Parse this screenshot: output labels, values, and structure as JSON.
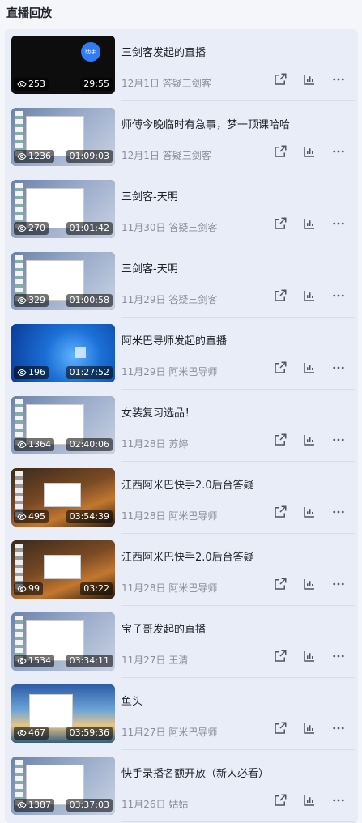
{
  "header": {
    "title": "直播回放"
  },
  "items": [
    {
      "title": "三剑客发起的直播",
      "date": "12月1日",
      "host": "答疑三剑客",
      "views": "253",
      "duration": "29:55",
      "scene": "dark"
    },
    {
      "title": "师傅今晚临时有急事，梦一顶课哈哈",
      "date": "12月1日",
      "host": "答疑三剑客",
      "views": "1236",
      "duration": "01:09:03",
      "scene": "desktop"
    },
    {
      "title": "三剑客-天明",
      "date": "11月30日",
      "host": "答疑三剑客",
      "views": "270",
      "duration": "01:01:42",
      "scene": "desktop"
    },
    {
      "title": "三剑客-天明",
      "date": "11月29日",
      "host": "答疑三剑客",
      "views": "329",
      "duration": "01:00:58",
      "scene": "desktop"
    },
    {
      "title": "阿米巴导师发起的直播",
      "date": "11月29日",
      "host": "阿米巴导师",
      "views": "196",
      "duration": "01:27:52",
      "scene": "win"
    },
    {
      "title": "女装复习选品！",
      "date": "11月28日",
      "host": "苏婷",
      "views": "1364",
      "duration": "02:40:06",
      "scene": "desktop"
    },
    {
      "title": "江西阿米巴快手2.0后台答疑",
      "date": "11月28日",
      "host": "阿米巴导师",
      "views": "495",
      "duration": "03:54:39",
      "scene": "tiger"
    },
    {
      "title": "江西阿米巴快手2.0后台答疑",
      "date": "11月28日",
      "host": "阿米巴导师",
      "views": "99",
      "duration": "03:22",
      "scene": "tiger"
    },
    {
      "title": "宝子哥发起的直播",
      "date": "11月27日",
      "host": "王清",
      "views": "1534",
      "duration": "03:34:11",
      "scene": "desktop"
    },
    {
      "title": "鱼头",
      "date": "11月27日",
      "host": "阿米巴导师",
      "views": "467",
      "duration": "03:59:36",
      "scene": "lake"
    },
    {
      "title": "快手录播名额开放（新人必看）",
      "date": "11月26日",
      "host": "姑姑",
      "views": "1387",
      "duration": "03:37:03",
      "scene": "desktop"
    }
  ],
  "avatar_text": "助手",
  "icons": {
    "share": "share-icon",
    "stats": "bar-chart-icon",
    "more": "more-icon",
    "views": "eye-icon"
  },
  "colors": {
    "panel": "#e9edf7",
    "meta": "#8a8f99",
    "title": "#1f2329"
  }
}
